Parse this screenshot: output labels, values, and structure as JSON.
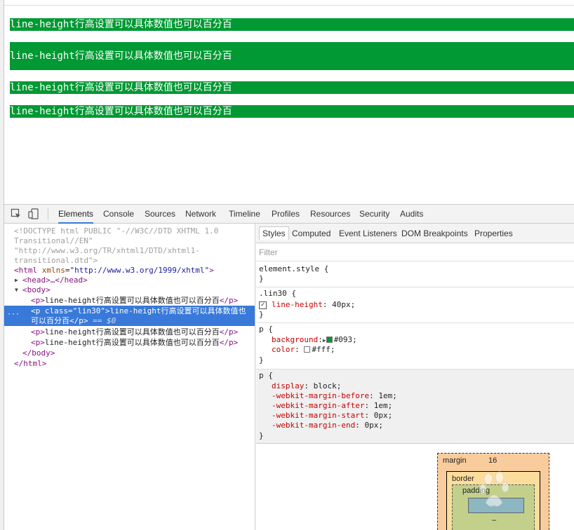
{
  "page": {
    "paragraphs": [
      {
        "text": "line-height行高设置可以具体数值也可以百分百"
      },
      {
        "text": "line-height行高设置可以具体数值也可以百分百"
      },
      {
        "text": "line-height行高设置可以具体数值也可以百分百"
      },
      {
        "text": "line-height行高设置可以具体数值也可以百分百"
      }
    ]
  },
  "devtools": {
    "tabs": [
      {
        "label": "Elements"
      },
      {
        "label": "Console"
      },
      {
        "label": "Sources"
      },
      {
        "label": "Network"
      },
      {
        "label": "Timeline"
      },
      {
        "label": "Profiles"
      },
      {
        "label": "Resources"
      },
      {
        "label": "Security"
      },
      {
        "label": "Audits"
      }
    ],
    "active_tab": "Elements",
    "elements": {
      "doctype_1": "<!DOCTYPE html PUBLIC \"-//W3C//DTD XHTML 1.0",
      "doctype_2": "Transitional//EN\"",
      "doctype_3": "\"http://www.w3.org/TR/xhtml1/DTD/xhtml1-",
      "doctype_4": "transitional.dtd\">",
      "html_open": "<html",
      "html_attr": "xmlns",
      "html_val": "\"http://www.w3.org/1999/xhtml\"",
      "html_close_bracket": ">",
      "head": "<head>…</head>",
      "body_open": "<body>",
      "p_open": "<p>",
      "p_close": "</p>",
      "p_text": "line-height行高设置可以具体数值也可以百分百",
      "sel_p_open": "<p",
      "sel_attr": "class",
      "sel_val": "\"lin30\"",
      "sel_text_1": "line-height行高设置可以具体数值也",
      "sel_text_2": "可以百分百",
      "sel_close": "</p>",
      "sel_eq": "== $0",
      "body_close": "</body>",
      "html_close": "</html>",
      "dots": "···",
      "equals": "=",
      "gt": ">"
    },
    "styles": {
      "tabs": [
        {
          "label": "Styles"
        },
        {
          "label": "Computed"
        },
        {
          "label": "Event Listeners"
        },
        {
          "label": "DOM Breakpoints"
        },
        {
          "label": "Properties"
        }
      ],
      "filter_placeholder": "Filter",
      "element_style_selector": "element.style {",
      "close_brace": "}",
      "rule_lin30": {
        "selector": ".lin30 {",
        "prop": "line-height",
        "value": "40px;"
      },
      "rule_p_author": {
        "selector": "p {",
        "prop1": "background",
        "value1": "#093;",
        "prop2": "color",
        "value2": "#fff;",
        "swatch1": "#009933",
        "swatch2": "#ffffff"
      },
      "rule_p_ua": {
        "selector": "p {",
        "props": [
          {
            "name": "display",
            "value": "block;"
          },
          {
            "name": "-webkit-margin-before",
            "value": "1em;"
          },
          {
            "name": "-webkit-margin-after",
            "value": "1em;"
          },
          {
            "name": "-webkit-margin-start",
            "value": "0px;"
          },
          {
            "name": "-webkit-margin-end",
            "value": "0px;"
          }
        ]
      },
      "colon": ":",
      "box_model": {
        "margin_label": "margin",
        "margin_value": "16",
        "border_label": "border",
        "padding_label": "padding",
        "content_value": "",
        "dash": "–"
      }
    }
  },
  "colors": {
    "paragraph_bg": "#009933",
    "accent": "#3879d9"
  }
}
